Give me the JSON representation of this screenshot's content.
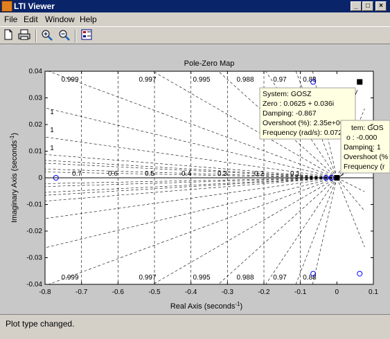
{
  "window": {
    "title": "LTI Viewer"
  },
  "menu": [
    "File",
    "Edit",
    "Window",
    "Help"
  ],
  "toolbar": {
    "icons": [
      "new-icon",
      "print-icon",
      "zoom-in-icon",
      "zoom-out-icon",
      "plot-config-icon"
    ]
  },
  "plot": {
    "title": "Pole-Zero Map",
    "xlabel": "Real Axis (seconds",
    "ylabel": "Imaginary Axis (seconds",
    "label_exponent": "-1",
    "x_ticks": [
      "-0.8",
      "-0.7",
      "-0.6",
      "-0.5",
      "-0.4",
      "-0.3",
      "-0.2",
      "-0.1",
      "0",
      "0.1"
    ],
    "y_ticks": [
      "0.04",
      "0.03",
      "0.02",
      "0.01",
      "0",
      "-0.01",
      "-0.02",
      "-0.03",
      "-0.04"
    ],
    "damping_top": [
      "0.999",
      "0.997",
      "0.995",
      "0.988",
      "0.97",
      "0.88"
    ],
    "damping_bottom": [
      "0.999",
      "0.997",
      "0.995",
      "0.988",
      "0.97",
      "0.88"
    ],
    "damping_axis": [
      "0.7",
      "0.6",
      "0.5",
      "0.4",
      "0.3",
      "0.2",
      "0.1"
    ],
    "left_edge_labels": [
      "1",
      "1",
      "1"
    ]
  },
  "chart_data": {
    "type": "scatter",
    "title": "Pole-Zero Map",
    "xlabel": "Real Axis (seconds-1)",
    "ylabel": "Imaginary Axis (seconds-1)",
    "xlim": [
      -0.8,
      0.1
    ],
    "ylim": [
      -0.04,
      0.04
    ],
    "grid": true,
    "series": [
      {
        "name": "zeros",
        "points": [
          [
            -0.77,
            0
          ],
          [
            0.0625,
            0.036
          ],
          [
            0.0625,
            -0.036
          ],
          [
            -0.065,
            0.036
          ],
          [
            -0.065,
            -0.036
          ],
          [
            -0.03,
            0
          ],
          [
            -0.015,
            0
          ]
        ]
      },
      {
        "name": "poles",
        "points": [
          [
            0.0625,
            0.036
          ],
          [
            0,
            0
          ]
        ]
      }
    ]
  },
  "tooltip1": {
    "lines": [
      "System: GOSZ",
      "Zero : 0.0625 + 0.036i",
      "Damping: -0.867",
      "Overshoot (%): 2.35e+004",
      "Frequency (rad/s): 0.0721"
    ]
  },
  "tooltip2": {
    "lines": [
      "tem: GOS",
      "o : -0.000",
      "Damping: 1",
      "Overshoot (%",
      "Frequency (r"
    ]
  },
  "status": {
    "text": "Plot type changed."
  }
}
